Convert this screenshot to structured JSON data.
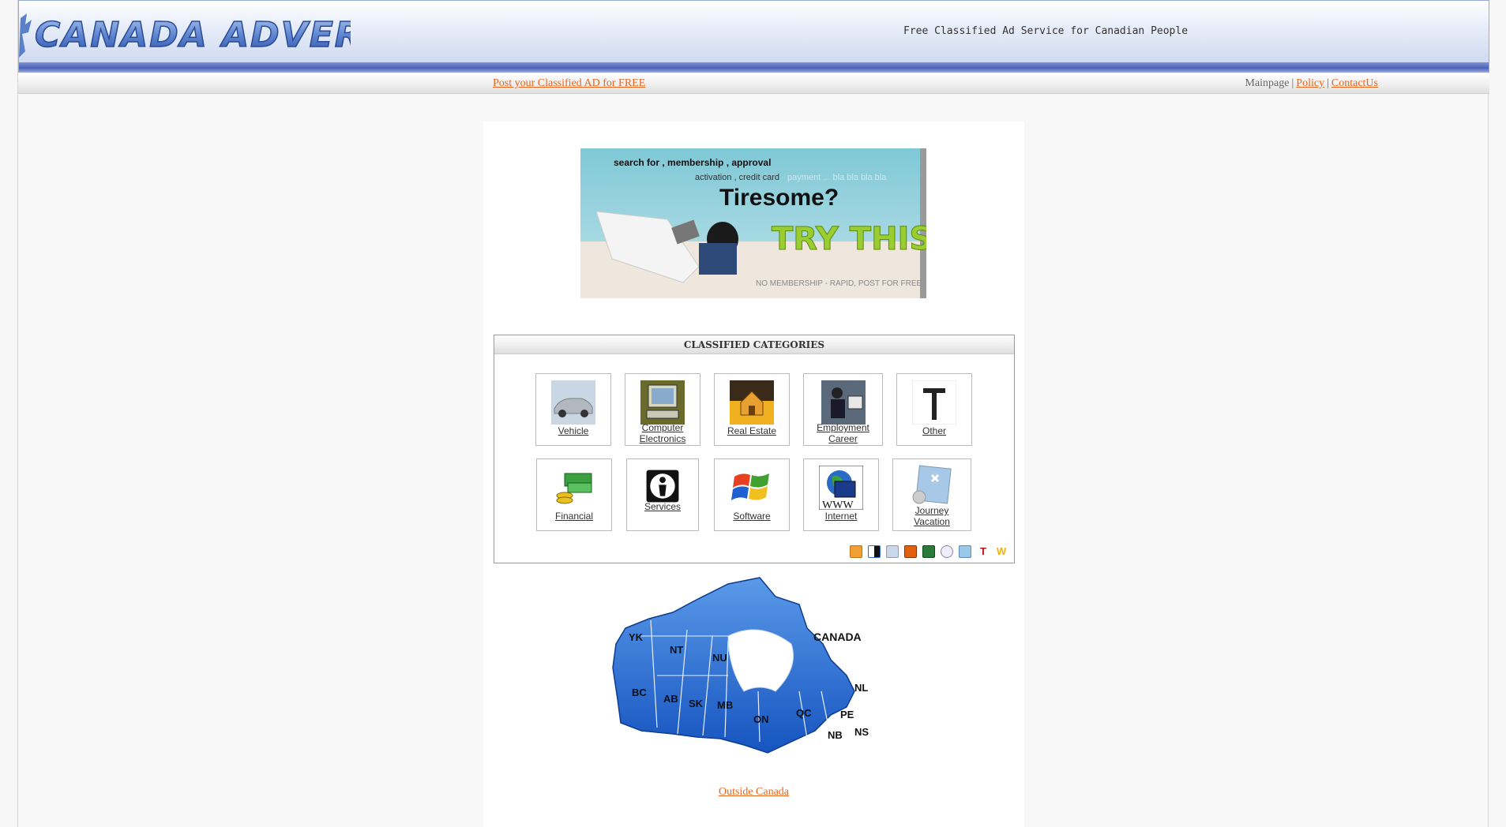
{
  "header": {
    "logo_text": "CANADA ADVERT",
    "tagline": "Free Classified Ad Service for Canadian People"
  },
  "nav": {
    "post_link": "Post your Classified AD for FREE",
    "mainpage": "Mainpage",
    "separator": "|",
    "policy": "Policy",
    "contact": "ContactUs"
  },
  "banner": {
    "line1": "search for , membership , approval",
    "line2a": "activation , credit card",
    "line2b": "payment ... bla bla bla bla",
    "headline": "Tiresome?",
    "cta": "TRY THIS",
    "footer": "NO MEMBERSHIP - RAPID, POST FOR FREE"
  },
  "categories": {
    "title": "CLASSIFIED CATEGORIES",
    "items": [
      {
        "label": "Vehicle",
        "icon": "car-icon"
      },
      {
        "label": "Computer\nElectronics",
        "icon": "computer-icon"
      },
      {
        "label": "Real Estate",
        "icon": "house-icon"
      },
      {
        "label": "Employment\nCareer",
        "icon": "person-at-computer-icon"
      },
      {
        "label": "Other",
        "icon": "hammer-icon"
      },
      {
        "label": "Financial",
        "icon": "money-icon"
      },
      {
        "label": "Services",
        "icon": "services-icon"
      },
      {
        "label": "Software",
        "icon": "windows-logo-icon"
      },
      {
        "label": "Internet",
        "icon": "globe-www-icon"
      },
      {
        "label": "Journey\nVacation",
        "icon": "map-pin-icon"
      }
    ]
  },
  "share_icons": [
    "bookmark-icon",
    "delicious-icon",
    "digg-icon",
    "furl-icon",
    "simpy-icon",
    "reddit-icon",
    "blinklist-icon",
    "technorati-icon",
    "wink-icon"
  ],
  "share_glyphs": {
    "technorati": "T",
    "wink": "W"
  },
  "map": {
    "country": "CANADA",
    "provinces": [
      "YK",
      "NT",
      "NU",
      "BC",
      "AB",
      "SK",
      "MB",
      "ON",
      "QC",
      "NL",
      "PE",
      "NB",
      "NS"
    ]
  },
  "outside_link": "Outside Canada",
  "colors": {
    "link": "#e8661c",
    "map_blue": "#1f6fd6",
    "header_stripe": "#4d62b8"
  }
}
